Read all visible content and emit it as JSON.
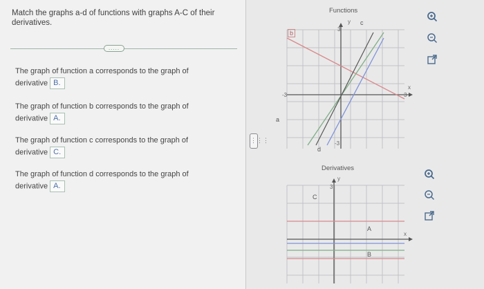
{
  "question": {
    "prompt": "Match the graphs a-d of functions with graphs A-C of their derivatives.",
    "more_label": "....."
  },
  "answers": [
    {
      "text": "The graph of function a corresponds to the graph of derivative",
      "value": "B."
    },
    {
      "text": "The graph of function b corresponds to the graph of derivative",
      "value": "A."
    },
    {
      "text": "The graph of function c corresponds to the graph of derivative",
      "value": "C."
    },
    {
      "text": "The graph of function d corresponds to the graph of derivative",
      "value": "A."
    }
  ],
  "splitter_label": "⋮⋮⋮",
  "functions_graph": {
    "title": "Functions",
    "y_axis": "y",
    "x_axis": "x",
    "tick_top": "3",
    "tick_left": "-3",
    "tick_right": "3",
    "tick_bottom": "-3",
    "labels": {
      "a": "a",
      "b": "b",
      "c": "c",
      "d": "d"
    }
  },
  "derivatives_graph": {
    "title": "Derivatives",
    "y_axis": "y",
    "x_axis": "x",
    "tick_top": "3",
    "labels": {
      "A": "A",
      "B": "B",
      "C": "C"
    }
  },
  "icons": {
    "zoom_in": "zoom-in-icon",
    "zoom_out": "zoom-out-icon",
    "open_external": "external-link-icon"
  },
  "colors": {
    "red_line": "#d98989",
    "green_line": "#7fae85",
    "blue_line": "#7f93d8",
    "grid": "#c3c3c6",
    "answer_text": "#4c6fa8"
  }
}
